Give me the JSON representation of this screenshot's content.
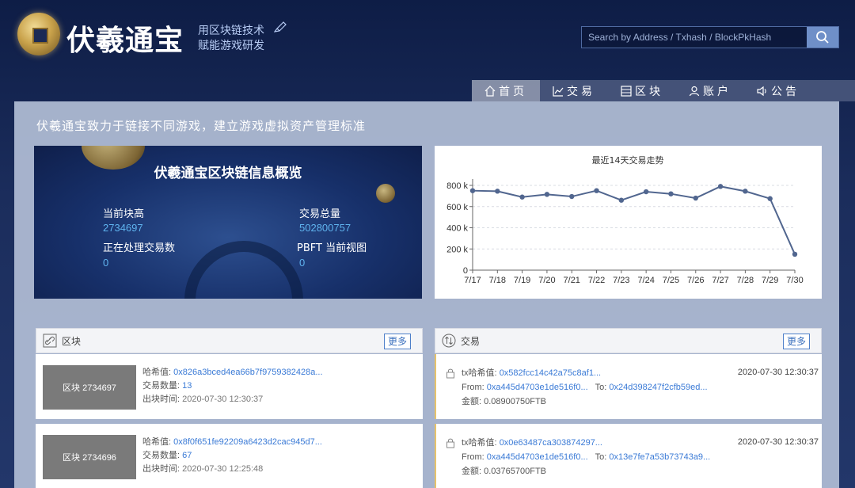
{
  "header": {
    "brand": "伏羲通宝",
    "slogan_line1": "用区块链技术",
    "slogan_line2": "赋能游戏研发",
    "search_placeholder": "Search by Address / Txhash / BlockPkHash"
  },
  "nav": {
    "items": [
      {
        "label": "首页",
        "icon": "home-icon"
      },
      {
        "label": "交易",
        "icon": "chart-icon"
      },
      {
        "label": "区块",
        "icon": "block-icon"
      },
      {
        "label": "账户",
        "icon": "user-icon"
      },
      {
        "label": "公告",
        "icon": "speaker-icon"
      }
    ]
  },
  "main": {
    "tagline": "伏羲通宝致力于链接不同游戏，建立游戏虚拟资产管理标准"
  },
  "overview": {
    "title": "伏羲通宝区块链信息概览",
    "block_height_label": "当前块高",
    "block_height": "2734697",
    "tx_total_label": "交易总量",
    "tx_total": "502800757",
    "pending_label": "正在处理交易数",
    "pending": "0",
    "pbft_label": "PBFT 当前视图",
    "pbft": "0"
  },
  "chart_data": {
    "type": "line",
    "title": "最近14天交易走势",
    "categories": [
      "7/17",
      "7/18",
      "7/19",
      "7/20",
      "7/21",
      "7/22",
      "7/23",
      "7/24",
      "7/25",
      "7/26",
      "7/27",
      "7/28",
      "7/29",
      "7/30"
    ],
    "values": [
      750000,
      745000,
      690000,
      715000,
      695000,
      750000,
      660000,
      740000,
      720000,
      680000,
      790000,
      745000,
      675000,
      150000
    ],
    "ylim": [
      0,
      800000
    ],
    "yticks": [
      "0",
      "200 k",
      "400 k",
      "600 k",
      "800 k"
    ],
    "color": "#51668f",
    "grid": true
  },
  "blocks": {
    "title": "区块",
    "more": "更多",
    "items": [
      {
        "box": "区块 2734697",
        "hash_label": "哈希值:",
        "hash": "0x826a3bced4ea66b7f9759382428a...",
        "count_label": "交易数量:",
        "count": "13",
        "time_label": "出块时间:",
        "time": "2020-07-30 12:30:37"
      },
      {
        "box": "区块 2734696",
        "hash_label": "哈希值:",
        "hash": "0x8f0f651fe92209a6423d2cac945d7...",
        "count_label": "交易数量:",
        "count": "67",
        "time_label": "出块时间:",
        "time": "2020-07-30 12:25:48"
      }
    ]
  },
  "transactions": {
    "title": "交易",
    "more": "更多",
    "items": [
      {
        "hash_label": "tx哈希值:",
        "hash": "0x582fcc14c42a75c8af1...",
        "time": "2020-07-30 12:30:37",
        "from_label": "From:",
        "from": "0xa445d4703e1de516f0...",
        "to_label": "To:",
        "to": "0x24d398247f2cfb59ed...",
        "amount_label": "金额:",
        "amount": "0.08900750FTB"
      },
      {
        "hash_label": "tx哈希值:",
        "hash": "0x0e63487ca303874297...",
        "time": "2020-07-30 12:30:37",
        "from_label": "From:",
        "from": "0xa445d4703e1de516f0...",
        "to_label": "To:",
        "to": "0x13e7fe7a53b73743a9...",
        "amount_label": "金额:",
        "amount": "0.03765700FTB"
      }
    ]
  }
}
